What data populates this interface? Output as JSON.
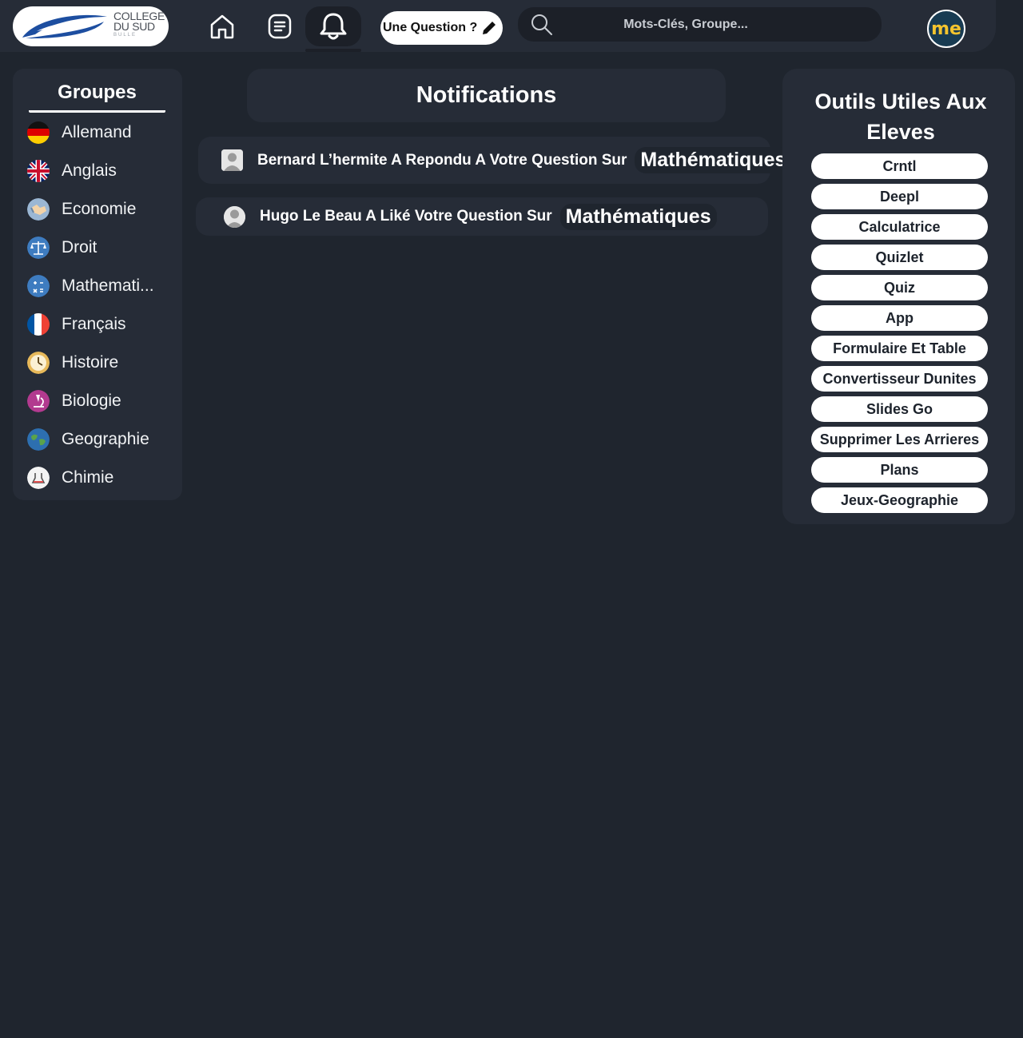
{
  "header": {
    "logo": {
      "line1": "COLLEGE",
      "line2": "DU SUD",
      "line3": "BULLE"
    },
    "nav": {
      "home_icon": "home-icon",
      "feed_icon": "list-icon",
      "bell_icon": "bell-icon"
    },
    "ask_label": "Une Question ?",
    "search_placeholder": "Mots-Clés, Groupe...",
    "avatar_text": "me"
  },
  "groups": {
    "title": "Groupes",
    "items": [
      {
        "label": "Allemand",
        "icon": "germany-flag-icon"
      },
      {
        "label": "Anglais",
        "icon": "uk-flag-icon"
      },
      {
        "label": "Economie",
        "icon": "handshake-icon"
      },
      {
        "label": "Droit",
        "icon": "scales-icon"
      },
      {
        "label": "Mathemati...",
        "icon": "math-icon"
      },
      {
        "label": "Français",
        "icon": "france-flag-icon"
      },
      {
        "label": "Histoire",
        "icon": "clock-icon"
      },
      {
        "label": "Biologie",
        "icon": "microscope-icon"
      },
      {
        "label": "Geographie",
        "icon": "globe-icon"
      },
      {
        "label": "Chimie",
        "icon": "lab-icon"
      }
    ]
  },
  "main": {
    "title": "Notifications",
    "notifications": [
      {
        "text": "Bernard L’hermite A Repondu A Votre Question Sur",
        "group": "Mathématiques"
      },
      {
        "text": "Hugo Le Beau A Liké Votre Question Sur",
        "group": "Mathématiques"
      }
    ]
  },
  "tools": {
    "title_line1": "Outils Utiles Aux",
    "title_line2": "Eleves",
    "items": [
      "Crntl",
      "Deepl",
      "Calculatrice",
      "Quizlet",
      "Quiz",
      "App",
      "Formulaire Et Table",
      "Convertisseur Dunites",
      "Slides Go",
      "Supprimer Les Arrieres",
      "Plans",
      "Jeux-Geographie"
    ]
  },
  "colors": {
    "background": "#1f252e",
    "panel": "#262c37",
    "accent_avatar": "#f2c42e"
  }
}
